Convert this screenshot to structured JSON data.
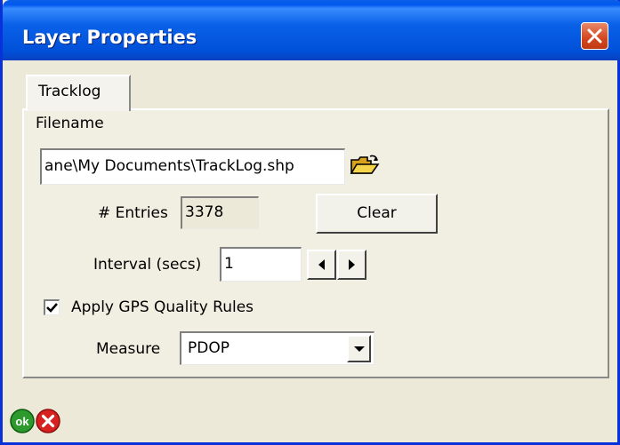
{
  "window": {
    "title": "Layer Properties"
  },
  "tabs": [
    {
      "label": "Tracklog"
    }
  ],
  "tracklog": {
    "filename_label": "Filename",
    "filename_value": "ane\\My Documents\\TrackLog.shp",
    "entries_label": "# Entries",
    "entries_value": "3378",
    "clear_label": "Clear",
    "interval_label": "Interval (secs)",
    "interval_value": "1",
    "gps_rules_label": "Apply GPS Quality Rules",
    "gps_rules_checked": true,
    "measure_label": "Measure",
    "measure_value": "PDOP"
  },
  "footer": {
    "ok_label": "ok"
  },
  "icons": {
    "close": "close-icon",
    "folder": "open-folder-icon",
    "ok": "ok-icon",
    "cancel": "cancel-icon"
  },
  "colors": {
    "titlebar": "#0a5ee6",
    "close": "#d3461f",
    "ok": "#2e9a2e",
    "cancel": "#d82020"
  }
}
